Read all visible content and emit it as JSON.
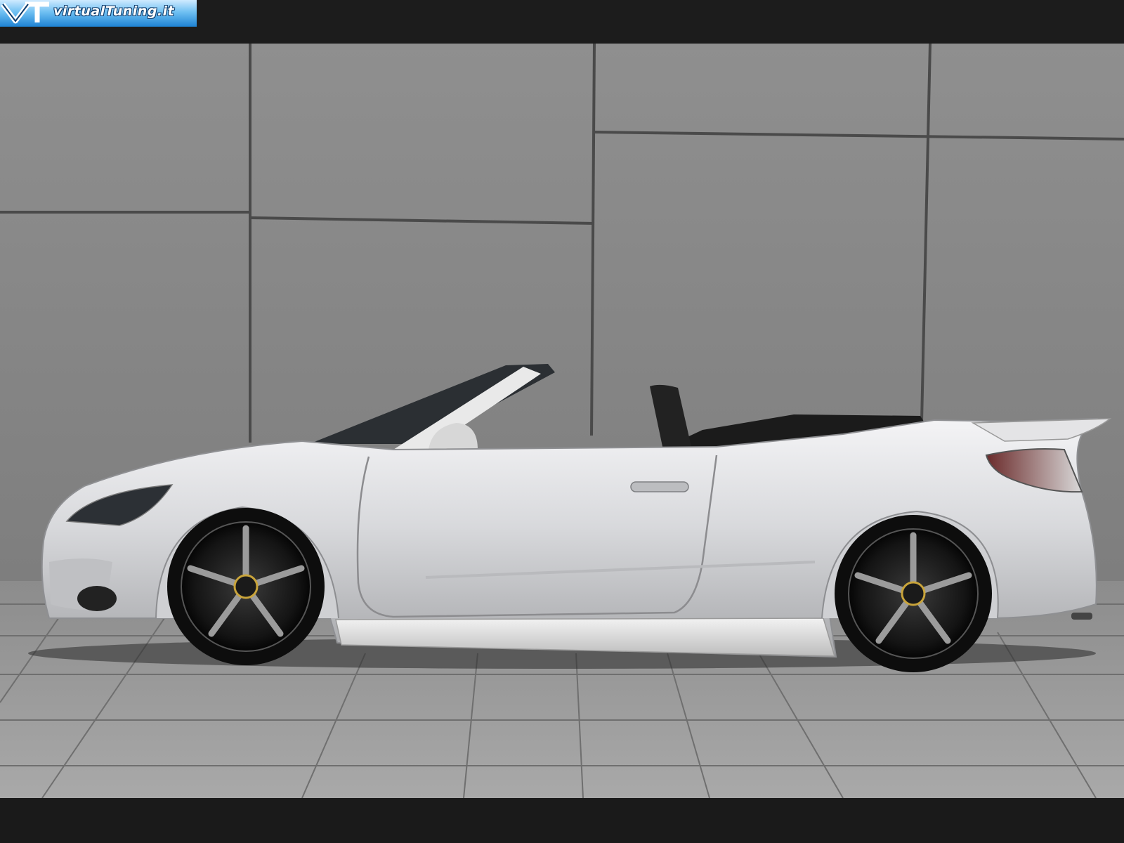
{
  "watermark": {
    "text": "virtualTuning.it",
    "monogram": "VT"
  },
  "colors": {
    "wall": "#8a8a8a",
    "pavement": "#9c9c9c",
    "car_body": "#d9dadd",
    "frame": "#1c1c1c",
    "logo_blue": "#3fa2e6"
  },
  "scene": {
    "subject": "silver convertible car",
    "background": "grey concrete wall panels",
    "ground": "stone paving tiles"
  }
}
